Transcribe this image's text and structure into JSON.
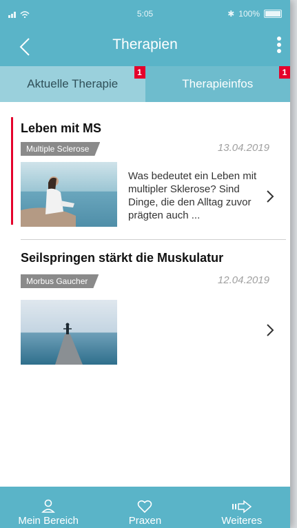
{
  "status": {
    "time": "5:05",
    "battery": "100%"
  },
  "header": {
    "title": "Therapien"
  },
  "tabs": [
    {
      "label": "Aktuelle Therapie",
      "badge": "1"
    },
    {
      "label": "Therapieinfos",
      "badge": "1"
    }
  ],
  "articles": [
    {
      "title": "Leben mit MS",
      "category": "Multiple Sclerose",
      "date": "13.04.2019",
      "excerpt": "Was bedeutet ein Leben mit multipler Sklerose? Sind Dinge, die den Alltag zuvor prägten auch ..."
    },
    {
      "title": "Seilspringen stärkt die Muskulatur",
      "category": "Morbus Gaucher",
      "date": "12.04.2019",
      "excerpt": ""
    }
  ],
  "bottom_nav": [
    {
      "label": "Mein Bereich",
      "icon": "person-icon"
    },
    {
      "label": "Praxen",
      "icon": "heart-icon"
    },
    {
      "label": "Weiteres",
      "icon": "arrow-right-icon"
    }
  ],
  "colors": {
    "primary": "#5ab4c8",
    "accent": "#e4002b"
  }
}
